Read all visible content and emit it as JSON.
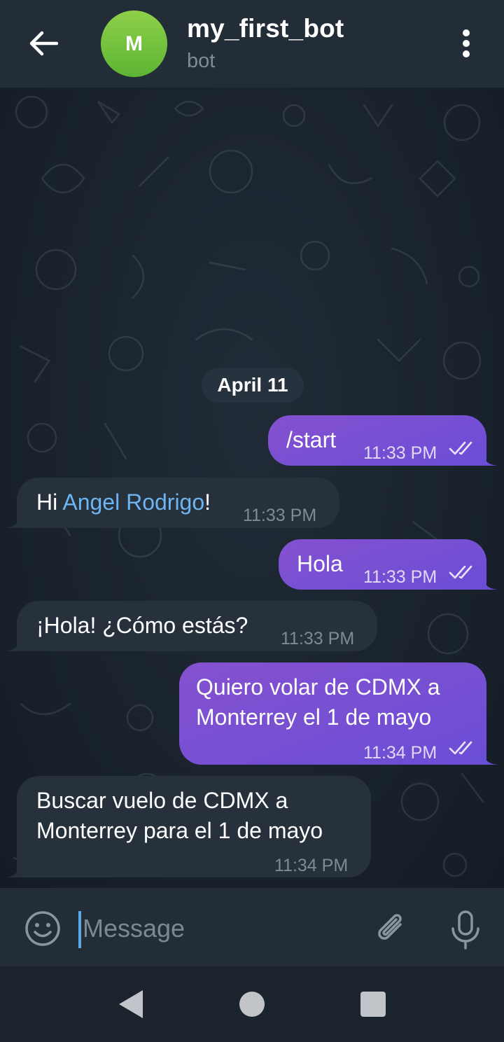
{
  "header": {
    "title": "my_first_bot",
    "subtitle": "bot",
    "avatar_letter": "M",
    "avatar_color": "#6fc23c"
  },
  "date_separator": "April 11",
  "messages": [
    {
      "direction": "out",
      "text": "/start",
      "time": "11:33 PM",
      "status": "read"
    },
    {
      "direction": "in",
      "prefix": "Hi ",
      "mention": "Angel Rodrigo",
      "suffix": "!",
      "time": "11:33 PM"
    },
    {
      "direction": "out",
      "text": "Hola",
      "time": "11:33 PM",
      "status": "read"
    },
    {
      "direction": "in",
      "text": "¡Hola! ¿Cómo estás?",
      "time": "11:33 PM"
    },
    {
      "direction": "out",
      "text": "Quiero volar de CDMX a\nMonterrey el 1 de mayo",
      "time": "11:34 PM",
      "status": "read"
    },
    {
      "direction": "in",
      "text": "Buscar vuelo de CDMX a\nMonterrey para el 1 de mayo",
      "time": "11:34 PM"
    }
  ],
  "composer": {
    "placeholder": "Message",
    "value": ""
  },
  "colors": {
    "outgoing_bubble": "#7a50d2",
    "incoming_bubble": "#26313c",
    "header": "#222d38",
    "mention": "#6cb5f2"
  },
  "icons": {
    "back": "arrow-left-icon",
    "menu": "more-vertical-icon",
    "emoji": "smiley-icon",
    "attach": "paperclip-icon",
    "mic": "microphone-icon",
    "read_status": "double-check-icon"
  }
}
